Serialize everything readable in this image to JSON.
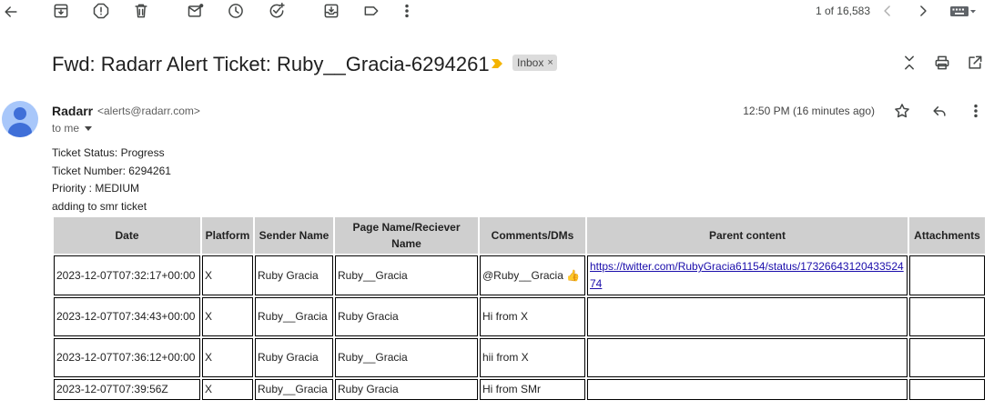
{
  "toolbar": {
    "icons": [
      "back-arrow-icon",
      "archive-icon",
      "report-spam-icon",
      "delete-icon",
      "mark-unread-icon",
      "snooze-icon",
      "add-to-tasks-icon",
      "move-to-icon",
      "label-icon",
      "more-vert-icon"
    ],
    "pager_text": "1 of 16,583"
  },
  "email": {
    "subject": "Fwd: Radarr Alert Ticket: Ruby__Gracia-6294261",
    "label": "Inbox",
    "label_close": "×",
    "sender_name": "Radarr",
    "sender_email": "<alerts@radarr.com>",
    "to": "to me",
    "timestamp": "12:50 PM (16 minutes ago)",
    "body_lines": [
      "Ticket Status: Progress",
      "Ticket Number: 6294261",
      "Priority : MEDIUM",
      "adding to smr ticket"
    ]
  },
  "table": {
    "headers": [
      "Date",
      "Platform",
      "Sender Name",
      "Page Name/Reciever Name",
      "Comments/DMs",
      "Parent content",
      "Attachments"
    ],
    "rows": [
      [
        "2023-12-07T07:32:17+00:00",
        "X",
        "Ruby Gracia",
        "Ruby__Gracia",
        "@Ruby__Gracia 👍",
        "https://twitter.com/RubyGracia61154/status/1732664312043352474",
        ""
      ],
      [
        "2023-12-07T07:34:43+00:00",
        "X",
        "Ruby__Gracia",
        "Ruby Gracia",
        "Hi from X",
        "",
        ""
      ],
      [
        "2023-12-07T07:36:12+00:00",
        "X",
        "Ruby Gracia",
        "Ruby__Gracia",
        "hii from X",
        "",
        ""
      ],
      [
        "2023-12-07T07:39:56Z",
        "X",
        "Ruby__Gracia",
        "Ruby Gracia",
        "Hi from SMr",
        "",
        ""
      ]
    ]
  },
  "colors": {
    "important_marker": "#f4b400",
    "avatar_bg": "#a8c7fa",
    "avatar_fg": "#3f6fd8",
    "header_bg": "#cfcfcf",
    "link": "#1a0dab"
  }
}
